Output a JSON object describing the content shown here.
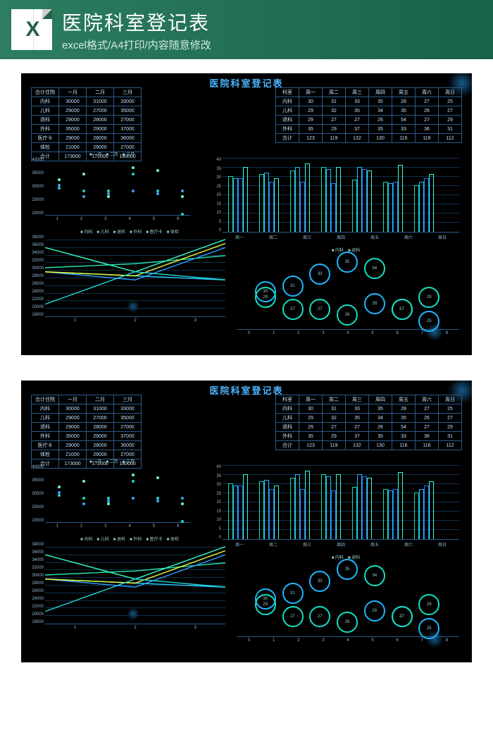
{
  "header": {
    "title": "医院科室登记表",
    "subtitle": "excel格式/A4打印/内容随意修改",
    "icon": "X"
  },
  "panel_title": "医院科室登记表",
  "left_table": {
    "head": [
      "合计住院",
      "一月",
      "二月",
      "三月"
    ],
    "rows": [
      [
        "内科",
        "30000",
        "31000",
        "33000"
      ],
      [
        "儿科",
        "29000",
        "27000",
        "35000"
      ],
      [
        "退科",
        "29000",
        "28000",
        "27000"
      ],
      [
        "外科",
        "35000",
        "29000",
        "37000"
      ],
      [
        "医疗卡",
        "29000",
        "28000",
        "36000"
      ],
      [
        "体检",
        "21000",
        "29000",
        "27000"
      ],
      [
        "合计",
        "173000",
        "172000",
        "180000"
      ]
    ]
  },
  "right_table": {
    "head": [
      "科室",
      "周一",
      "周二",
      "周三",
      "周四",
      "周五",
      "周六",
      "周日"
    ],
    "rows": [
      [
        "内科",
        "30",
        "31",
        "33",
        "35",
        "28",
        "27",
        "25"
      ],
      [
        "儿科",
        "29",
        "32",
        "35",
        "34",
        "35",
        "26",
        "27"
      ],
      [
        "退科",
        "29",
        "27",
        "27",
        "26",
        "54",
        "27",
        "29"
      ],
      [
        "外科",
        "35",
        "29",
        "37",
        "35",
        "33",
        "36",
        "31"
      ],
      [
        "合计",
        "123",
        "119",
        "132",
        "130",
        "116",
        "116",
        "112"
      ]
    ]
  },
  "chart_data": {
    "scatter": {
      "type": "scatter",
      "title": "",
      "legend": [
        "一月",
        "二月",
        "三月"
      ],
      "x": [
        1,
        2,
        3,
        4,
        5,
        6
      ],
      "ylim": [
        20000,
        40000
      ],
      "yticks": [
        "20000",
        "25000",
        "30000",
        "35000",
        "40000"
      ],
      "series": [
        {
          "name": "一月",
          "color": "#21d3c8",
          "values": [
            30000,
            29000,
            29000,
            35000,
            29000,
            21000
          ]
        },
        {
          "name": "二月",
          "color": "#3ea0ff",
          "values": [
            31000,
            27000,
            28000,
            29000,
            28000,
            29000
          ]
        },
        {
          "name": "三月",
          "color": "#6fffc6",
          "values": [
            33000,
            35000,
            27000,
            37000,
            36000,
            27000
          ]
        }
      ]
    },
    "bars": {
      "type": "bar",
      "categories": [
        "周一",
        "周二",
        "周三",
        "周四",
        "周五",
        "周六",
        "周日"
      ],
      "ylim": [
        0,
        40
      ],
      "yticks": [
        "0",
        "5",
        "10",
        "15",
        "20",
        "25",
        "30",
        "35",
        "40"
      ],
      "series": [
        {
          "name": "内科",
          "color": "#17e0b2",
          "values": [
            30,
            31,
            33,
            35,
            28,
            27,
            25
          ]
        },
        {
          "name": "儿科",
          "color": "#20c0ff",
          "values": [
            29,
            32,
            35,
            34,
            35,
            26,
            27
          ]
        },
        {
          "name": "退科",
          "color": "#2a74ff",
          "values": [
            29,
            27,
            27,
            26,
            34,
            27,
            29
          ]
        },
        {
          "name": "外科",
          "color": "#38ffe0",
          "values": [
            35,
            29,
            37,
            35,
            33,
            36,
            31
          ]
        }
      ]
    },
    "lines": {
      "type": "line",
      "x": [
        1,
        2,
        3
      ],
      "ylim": [
        18000,
        38000
      ],
      "yticks": [
        "18000",
        "20000",
        "22000",
        "24000",
        "26000",
        "28000",
        "30000",
        "32000",
        "34000",
        "36000",
        "38000"
      ],
      "legend": [
        "内科",
        "儿科",
        "退科",
        "外科",
        "医疗卡",
        "体检"
      ],
      "series": [
        {
          "name": "内科",
          "color": "#22e0b0",
          "values": [
            30000,
            31000,
            33000
          ]
        },
        {
          "name": "儿科",
          "color": "#2a9fff",
          "values": [
            29000,
            27000,
            35000
          ]
        },
        {
          "name": "退科",
          "color": "#28c8ff",
          "values": [
            29000,
            28000,
            27000
          ]
        },
        {
          "name": "外科",
          "color": "#3affc0",
          "values": [
            35000,
            29000,
            37000
          ]
        },
        {
          "name": "医疗卡",
          "color": "#e8ff3a",
          "values": [
            29000,
            28000,
            36000
          ]
        },
        {
          "name": "体检",
          "color": "#20d8d8",
          "values": [
            21000,
            29000,
            27000
          ]
        }
      ]
    },
    "bubbles": {
      "type": "scatter",
      "legend": [
        "内科",
        "退科"
      ],
      "xlim": [
        0,
        8
      ],
      "ylim": [
        24,
        36
      ],
      "series": [
        {
          "name": "内科",
          "color": "#1fb8ff",
          "points": [
            [
              1,
              30
            ],
            [
              2,
              31
            ],
            [
              3,
              33
            ],
            [
              4,
              35
            ],
            [
              5,
              28
            ],
            [
              6,
              27
            ],
            [
              7,
              25
            ]
          ]
        },
        {
          "name": "退科",
          "color": "#14e0c0",
          "points": [
            [
              1,
              29
            ],
            [
              2,
              27
            ],
            [
              3,
              27
            ],
            [
              4,
              26
            ],
            [
              5,
              34
            ],
            [
              6,
              27
            ],
            [
              7,
              29
            ]
          ]
        }
      ]
    }
  }
}
